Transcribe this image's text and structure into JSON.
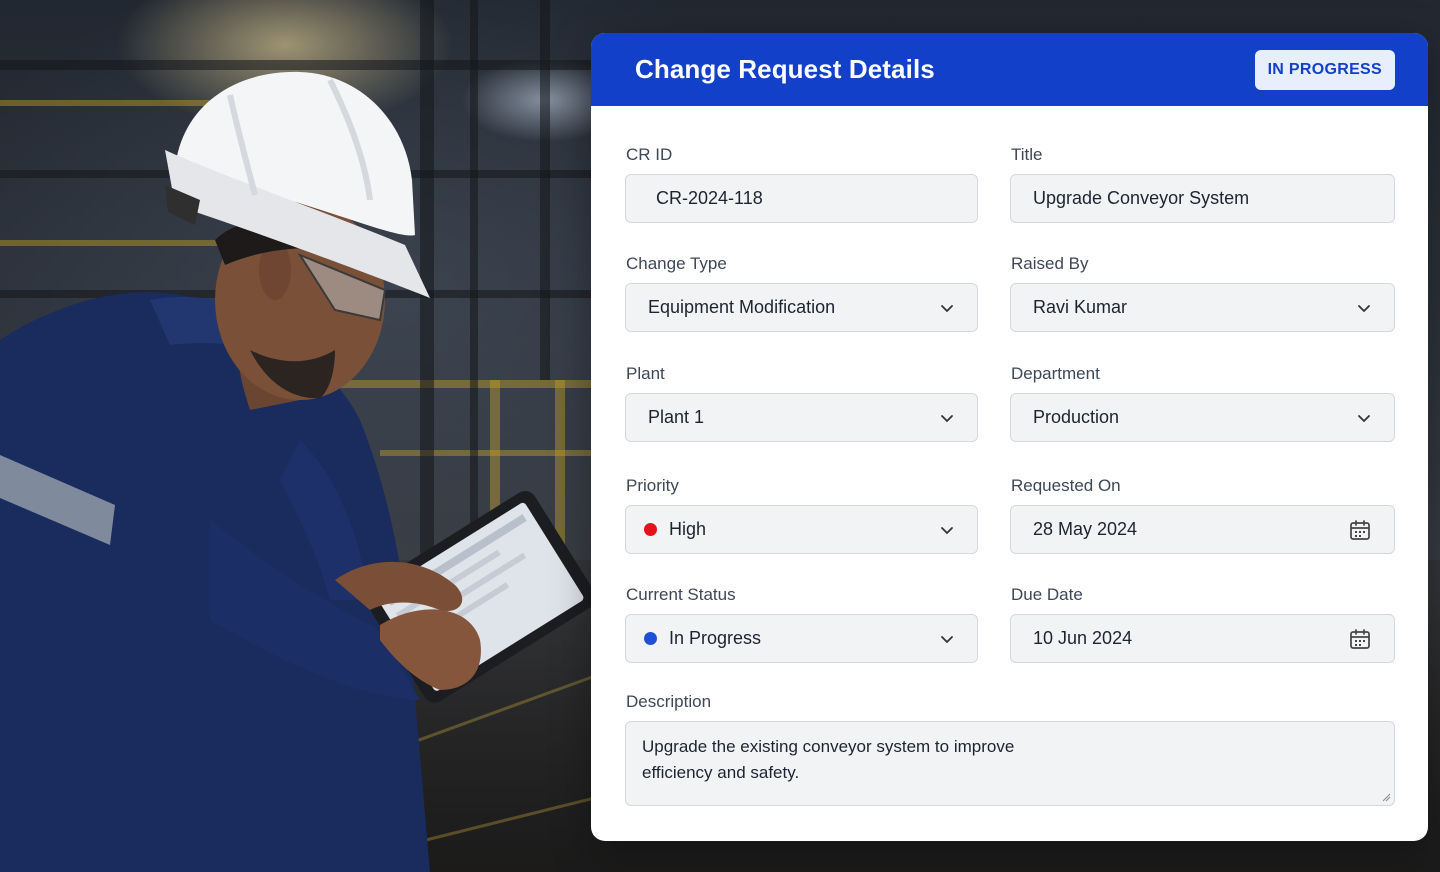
{
  "card": {
    "title": "Change Request Details",
    "status_badge": "IN PROGRESS"
  },
  "fields": {
    "cr_id": {
      "label": "CR ID",
      "value": "CR-2024-118"
    },
    "title": {
      "label": "Title",
      "value": "Upgrade Conveyor System"
    },
    "change_type": {
      "label": "Change Type",
      "value": "Equipment Modification"
    },
    "raised_by": {
      "label": "Raised By",
      "value": "Ravi Kumar"
    },
    "plant": {
      "label": "Plant",
      "value": "Plant 1"
    },
    "department": {
      "label": "Department",
      "value": "Production"
    },
    "priority": {
      "label": "Priority",
      "value": "High",
      "dot_color": "#e3131b"
    },
    "requested_on": {
      "label": "Requested On",
      "value": "28 May 2024"
    },
    "current_status": {
      "label": "Current Status",
      "value": "In Progress",
      "dot_color": "#1d4fd8"
    },
    "due_date": {
      "label": "Due Date",
      "value": "10 Jun 2024"
    },
    "description": {
      "label": "Description",
      "lines": [
        "Upgrade the existing conveyor system to improve",
        "efficiency and safety."
      ]
    }
  },
  "icons": {
    "dropdown": "chevron-down-icon",
    "date": "calendar-icon"
  },
  "colors": {
    "header_bg": "#1240c8",
    "badge_bg": "#e8eefc",
    "badge_text": "#1240c8",
    "field_bg": "#f2f3f5"
  }
}
